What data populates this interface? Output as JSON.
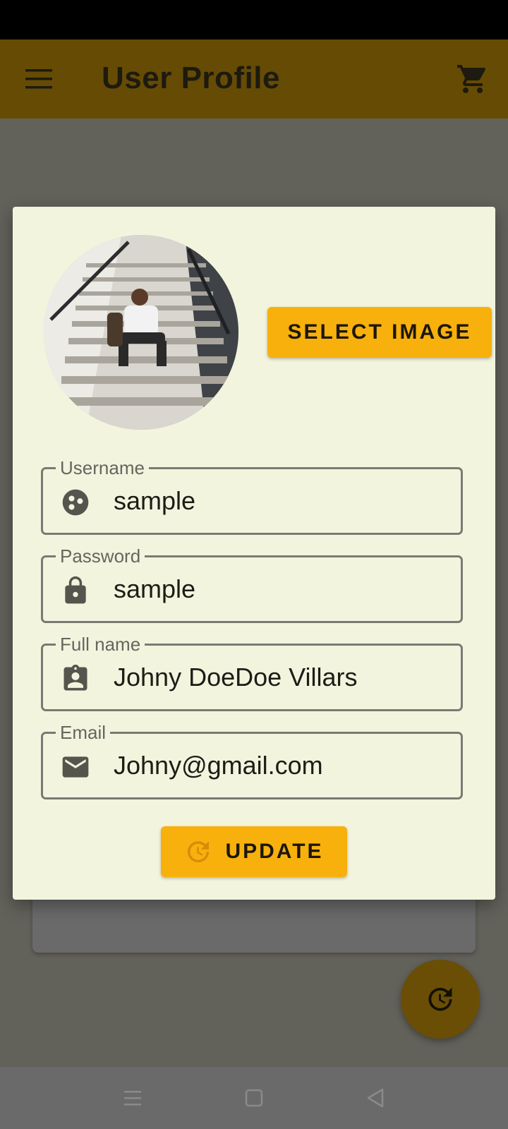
{
  "app_bar": {
    "title": "User Profile",
    "menu_icon": "menu-icon",
    "cart_icon": "cart-icon"
  },
  "dialog": {
    "select_image_label": "SELECT IMAGE",
    "fields": [
      {
        "label": "Username",
        "value": "sample",
        "icon": "account-face-icon"
      },
      {
        "label": "Password",
        "value": "sample",
        "icon": "lock-icon"
      },
      {
        "label": "Full name",
        "value": "Johny DoeDoe Villars",
        "icon": "badge-icon"
      },
      {
        "label": "Email",
        "value": "Johny@gmail.com",
        "icon": "mail-icon"
      }
    ],
    "update_label": "UPDATE",
    "update_icon": "update-icon"
  },
  "fab": {
    "icon": "update-icon"
  },
  "colors": {
    "accent": "#f8b00c",
    "app_bar": "#664b05",
    "dialog_bg": "#f3f4de"
  }
}
